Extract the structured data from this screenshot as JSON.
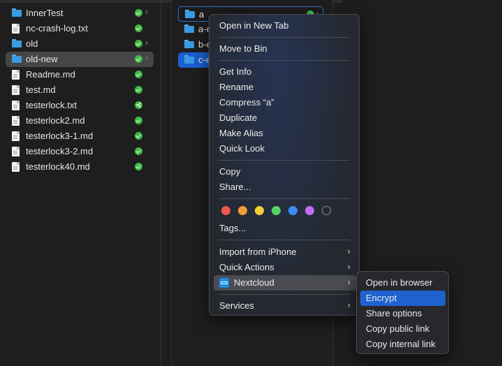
{
  "column1": {
    "items": [
      {
        "name": "InnerTest",
        "type": "folder",
        "sync": "ok",
        "chevron": true
      },
      {
        "name": "nc-crash-log.txt",
        "type": "doc",
        "sync": "ok"
      },
      {
        "name": "old",
        "type": "folder",
        "sync": "ok",
        "chevron": true
      },
      {
        "name": "old-new",
        "type": "folder",
        "sync": "ok",
        "chevron": true,
        "selected": true
      },
      {
        "name": "Readme.md",
        "type": "doc",
        "sync": "ok"
      },
      {
        "name": "test.md",
        "type": "doc",
        "sync": "ok"
      },
      {
        "name": "testerlock.txt",
        "type": "doc",
        "sync": "shared"
      },
      {
        "name": "testerlock2.md",
        "type": "doc",
        "sync": "ok"
      },
      {
        "name": "testerlock3-1.md",
        "type": "doc",
        "sync": "ok"
      },
      {
        "name": "testerlock3-2.md",
        "type": "doc",
        "sync": "ok"
      },
      {
        "name": "testerlock40.md",
        "type": "doc",
        "sync": "ok"
      }
    ]
  },
  "column2": {
    "items": [
      {
        "name": "a",
        "state": "editing"
      },
      {
        "name": "a-e",
        "state": "normal"
      },
      {
        "name": "b-e",
        "state": "normal"
      },
      {
        "name": "c-e",
        "state": "selected"
      }
    ]
  },
  "context_menu": {
    "open_new_tab": "Open in New Tab",
    "move_to_bin": "Move to Bin",
    "get_info": "Get Info",
    "rename": "Rename",
    "compress": "Compress “a”",
    "duplicate": "Duplicate",
    "make_alias": "Make Alias",
    "quick_look": "Quick Look",
    "copy": "Copy",
    "share": "Share...",
    "tag_colors": [
      "#f0554f",
      "#f29d38",
      "#f5cf3a",
      "#55d363",
      "#3a8ef5",
      "#c56ef0",
      "gray-outline"
    ],
    "tags": "Tags...",
    "import_iphone": "Import from iPhone",
    "quick_actions": "Quick Actions",
    "nextcloud": "Nextcloud",
    "services": "Services"
  },
  "submenu": {
    "open_browser": "Open in browser",
    "encrypt": "Encrypt",
    "share_options": "Share options",
    "copy_public_link": "Copy public link",
    "copy_internal_link": "Copy internal link"
  },
  "colors": {
    "selection_blue": "#1f62cf",
    "sync_green": "#3fba45",
    "folder_blue": "#3b9be0"
  }
}
